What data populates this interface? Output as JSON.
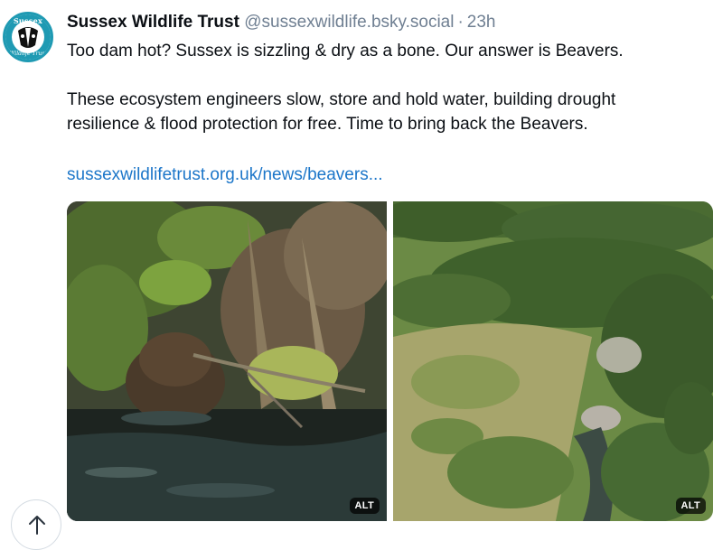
{
  "post": {
    "author_name": "Sussex Wildlife Trust",
    "handle": "@sussexwildlife.bsky.social",
    "separator": "·",
    "time": "23h",
    "text_line1": "Too dam hot? Sussex is sizzling & dry as a bone. Our answer is Beavers.",
    "text_line2": "These ecosystem engineers slow, store and hold water, building drought",
    "text_line3": "resilience & flood protection for free. Time to bring back the Beavers.",
    "link_text": "sussexwildlifetrust.org.uk/news/beavers..."
  },
  "avatar": {
    "logo_text_top": "Sussex",
    "logo_text_bottom": "Wildlife Trust",
    "icon": "badger-logo"
  },
  "images": [
    {
      "alt_label": "ALT",
      "subject": "beaver-in-water"
    },
    {
      "alt_label": "ALT",
      "subject": "aerial-wetland"
    }
  ],
  "scroll_top": {
    "icon": "arrow-up-icon"
  },
  "colors": {
    "link": "#1c76c9",
    "muted": "#6f7f92",
    "avatar_ring": "#1f9ab3"
  }
}
